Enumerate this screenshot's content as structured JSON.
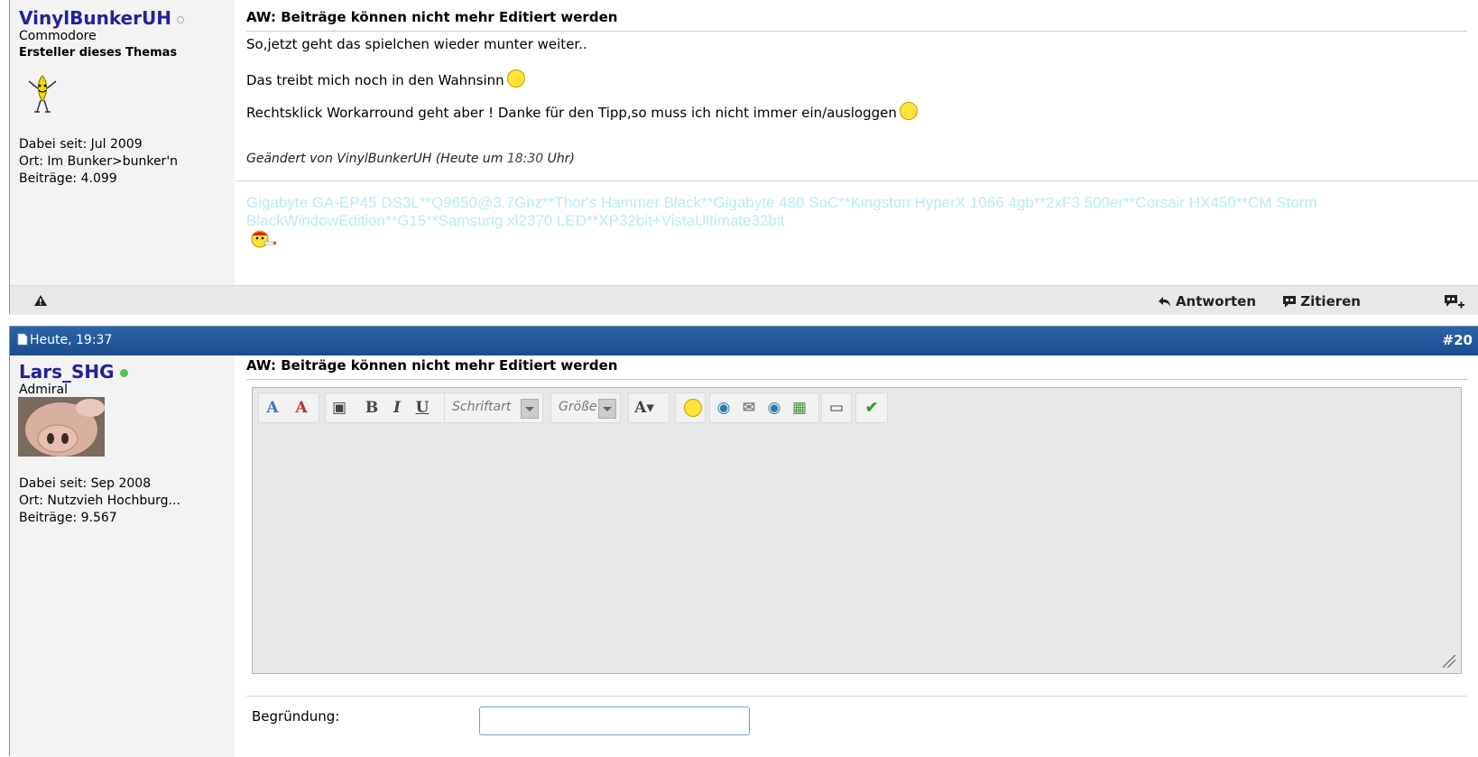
{
  "post1": {
    "username": "VinylBunkerUH",
    "rank": "Commodore",
    "starter_label": "Ersteller dieses Themas",
    "joined": "Dabei seit: Jul 2009",
    "location": "Ort: Im Bunker>bunker'n",
    "posts": "Beiträge: 4.099",
    "title": "AW: Beiträge können nicht mehr Editiert werden",
    "lines": [
      "So,jetzt geht das spielchen wieder munter weiter..",
      "Das treibt mich noch in den Wahnsinn",
      "Rechtsklick Workarround geht aber ! Danke für den Tipp,so muss ich nicht immer ein/ausloggen"
    ],
    "edited_prefix": "Geändert von VinylBunkerUH (Heute um ",
    "edited_time": "18:30",
    "edited_suffix": " Uhr)",
    "signature": "Gigabyte GA-EP45 DS3L**Q9650@3.7Ghz**Thor's Hammer Black**Gigabyte 480 SoC**Kingston HyperX 1066 4gb**2xF3 500er**Corsair HX450**CM Storm BlackWindowEdition**G15**Samsung xl2370 LED**XP32bit+VistaUltimate32bit",
    "footer": {
      "reply": "Antworten",
      "quote": "Zitieren"
    }
  },
  "post2": {
    "date": "Heute, 19:37",
    "number": "#20",
    "username": "Lars_SHG",
    "rank": "Admiral",
    "joined": "Dabei seit: Sep 2008",
    "location": "Ort: Nutzvieh Hochburg...",
    "posts": "Beiträge: 9.567",
    "title": "AW: Beiträge können nicht mehr Editiert werden",
    "editor": {
      "font_placeholder": "Schriftart",
      "size_placeholder": "Größe"
    },
    "reason_label": "Begründung:"
  },
  "colors": {
    "username": "#22229c",
    "header": "#1a4d8e",
    "signature": "#b8ecf2"
  }
}
